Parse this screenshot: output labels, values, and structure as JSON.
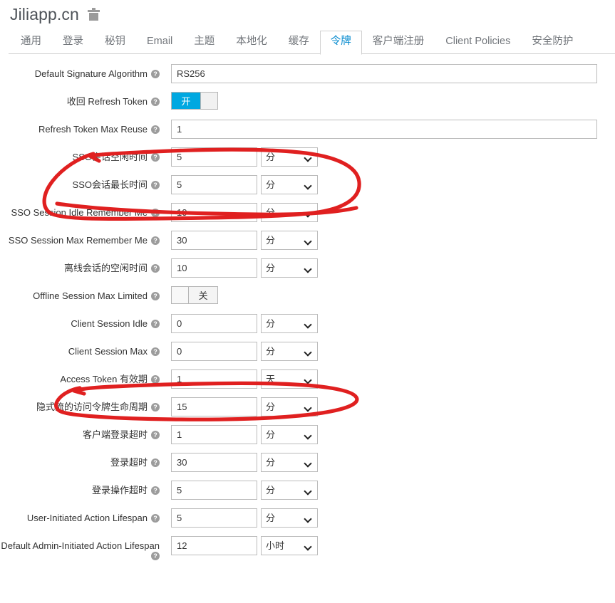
{
  "header": {
    "realm_name": "Jiliapp.cn",
    "delete_icon": "trash-icon"
  },
  "tabs": [
    {
      "label": "通用",
      "active": false
    },
    {
      "label": "登录",
      "active": false
    },
    {
      "label": "秘钥",
      "active": false
    },
    {
      "label": "Email",
      "active": false
    },
    {
      "label": "主题",
      "active": false
    },
    {
      "label": "本地化",
      "active": false
    },
    {
      "label": "缓存",
      "active": false
    },
    {
      "label": "令牌",
      "active": true
    },
    {
      "label": "客户端注册",
      "active": false
    },
    {
      "label": "Client Policies",
      "active": false
    },
    {
      "label": "安全防护",
      "active": false
    }
  ],
  "help_glyph": "?",
  "units": {
    "minutes": "分",
    "hours": "小时",
    "days": "天"
  },
  "toggle_labels": {
    "on": "开",
    "off": "关"
  },
  "colors": {
    "accent": "#0088ce",
    "toggle_on": "#00a8e1",
    "annotation_red": "#e02020",
    "label_text": "#333333",
    "tab_inactive": "#72767b"
  },
  "form_rows": [
    {
      "label": "Default Signature Algorithm",
      "type": "text-wide",
      "value": "RS256",
      "name": "default-signature-algorithm"
    },
    {
      "label": "收回 Refresh Token",
      "type": "toggle",
      "value": "on",
      "toggle_text": "开",
      "name": "revoke-refresh-token"
    },
    {
      "label": "Refresh Token Max Reuse",
      "type": "text-wide",
      "value": "1",
      "name": "refresh-token-max-reuse"
    },
    {
      "label": "SSO会话空闲时间",
      "type": "text-unit",
      "value": "5",
      "unit": "分",
      "name": "sso-session-idle"
    },
    {
      "label": "SSO会话最长时间",
      "type": "text-unit",
      "value": "5",
      "unit": "分",
      "name": "sso-session-max"
    },
    {
      "label": "SSO Session Idle Remember Me",
      "type": "text-unit",
      "value": "10",
      "unit": "分",
      "name": "sso-session-idle-remember-me"
    },
    {
      "label": "SSO Session Max Remember Me",
      "type": "text-unit",
      "value": "30",
      "unit": "分",
      "name": "sso-session-max-remember-me"
    },
    {
      "label": "离线会话的空闲时间",
      "type": "text-unit",
      "value": "10",
      "unit": "分",
      "name": "offline-session-idle"
    },
    {
      "label": "Offline Session Max Limited",
      "type": "toggle",
      "value": "off",
      "toggle_text": "关",
      "name": "offline-session-max-limited"
    },
    {
      "label": "Client Session Idle",
      "type": "text-unit",
      "value": "0",
      "unit": "分",
      "name": "client-session-idle"
    },
    {
      "label": "Client Session Max",
      "type": "text-unit",
      "value": "0",
      "unit": "分",
      "name": "client-session-max"
    },
    {
      "label": "Access Token 有效期",
      "type": "text-unit",
      "value": "1",
      "unit": "天",
      "name": "access-token-lifespan"
    },
    {
      "label": "隐式流的访问令牌生命周期",
      "type": "text-unit",
      "value": "15",
      "unit": "分",
      "name": "access-token-lifespan-implicit-flow"
    },
    {
      "label": "客户端登录超时",
      "type": "text-unit",
      "value": "1",
      "unit": "分",
      "name": "client-login-timeout"
    },
    {
      "label": "登录超时",
      "type": "text-unit",
      "value": "30",
      "unit": "分",
      "name": "login-timeout"
    },
    {
      "label": "登录操作超时",
      "type": "text-unit",
      "value": "5",
      "unit": "分",
      "name": "login-action-timeout"
    },
    {
      "label": "User-Initiated Action Lifespan",
      "type": "text-unit",
      "value": "5",
      "unit": "分",
      "name": "user-initiated-action-lifespan"
    },
    {
      "label": "Default Admin-Initiated Action Lifespan",
      "type": "text-unit",
      "value": "12",
      "unit": "小时",
      "name": "default-admin-initiated-action-lifespan"
    }
  ],
  "annotations": [
    {
      "name": "annotation-sso-session-rows",
      "shape": "hand-drawn-ellipse",
      "color": "#e02020"
    },
    {
      "name": "annotation-access-token-lifespan",
      "shape": "hand-drawn-ellipse",
      "color": "#e02020"
    }
  ]
}
